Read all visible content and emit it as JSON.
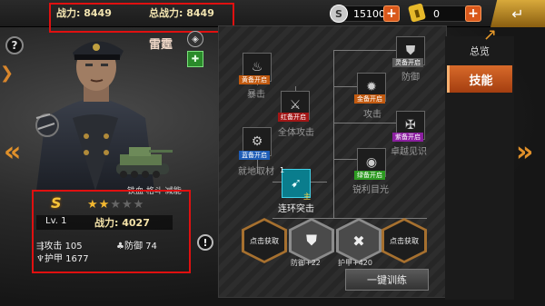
{
  "top": {
    "power_label": "战力: 8449",
    "total_power_label": "总战力: 8449",
    "silver": {
      "icon": "S",
      "value": "15100",
      "add": "+"
    },
    "gold": {
      "value": "0",
      "add": "+"
    },
    "back_icon": "back-arrow-icon"
  },
  "hero": {
    "name": "雷霆",
    "tags": "铁血 格斗 减能",
    "grade": "S",
    "stars_filled": 2,
    "stars_total": 5,
    "level": "Lv. 1",
    "power": "战力: 4027",
    "attack": "攻击 105",
    "defense": "防御 74",
    "armor": "护甲 1677",
    "help": "?",
    "alert": "!"
  },
  "tabs": {
    "overview": "总览",
    "skills": "技能"
  },
  "skills": [
    {
      "badge": "灵备开启",
      "name": "防御",
      "active": false
    },
    {
      "badge": "黄备开启",
      "name": "暴击",
      "active": false
    },
    {
      "badge": "金备开启",
      "name": "攻击",
      "active": false
    },
    {
      "badge": "红备开启",
      "name": "全体攻击",
      "active": false
    },
    {
      "badge": "紫备开启",
      "name": "卓越见识",
      "active": false
    },
    {
      "badge": "蓝备开启",
      "name": "就地取材",
      "active": false
    },
    {
      "badge": "绿备开启",
      "name": "锐利目光",
      "active": false
    },
    {
      "badge": "",
      "name": "连环突击",
      "active": true,
      "level": "1",
      "main": "主"
    }
  ],
  "equipment": [
    {
      "label": "点击获取",
      "stat": ""
    },
    {
      "label": "",
      "stat": "防御+22"
    },
    {
      "label": "",
      "stat": "护甲+420"
    },
    {
      "label": "点击获取",
      "stat": ""
    }
  ],
  "train_button": "一键训练",
  "colors": {
    "accent": "#d86a2a",
    "highlight_box": "#e01010",
    "active_skill": "#0a7d8d"
  }
}
